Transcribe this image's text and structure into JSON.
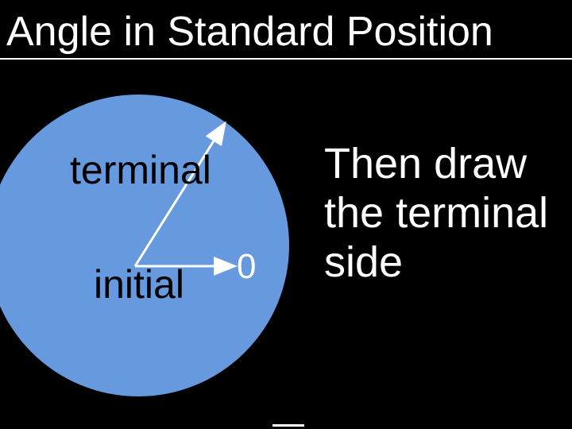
{
  "title": "Angle in Standard Position",
  "labels": {
    "terminal": "terminal",
    "initial": "initial",
    "zero": "0"
  },
  "instruction": "Then draw the terminal side",
  "colors": {
    "background": "#000000",
    "circle": "#6699dd",
    "text_light": "#ffffff",
    "text_dark": "#000000"
  }
}
